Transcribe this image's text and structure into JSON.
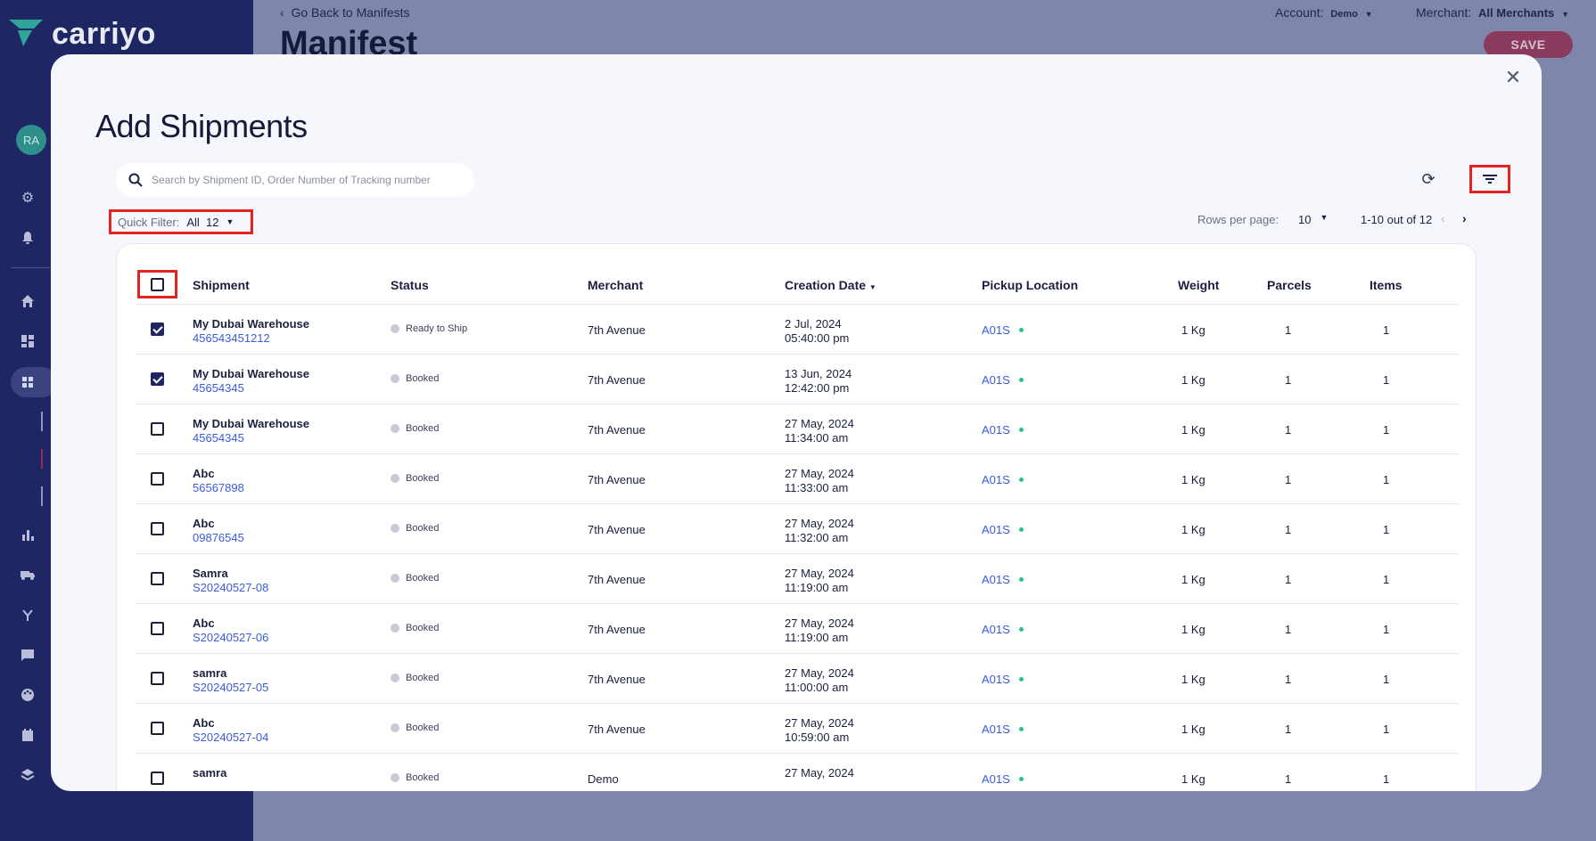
{
  "sidebar": {
    "brand": "carriyo",
    "avatar_initials": "RA",
    "icons": [
      "settings-icon",
      "bell-icon",
      "home-icon",
      "dashboard-icon",
      "shipments-icon",
      "analytics-icon",
      "truck-icon",
      "routing-icon",
      "chat-icon",
      "palette-icon",
      "calendar-icon",
      "layers-icon"
    ]
  },
  "background": {
    "back_link": "Go Back to Manifests",
    "page_title": "Manifest",
    "account_label": "Account:",
    "account_value": "Demo",
    "merchant_label": "Merchant:",
    "merchant_value": "All Merchants",
    "save_label": "SAVE"
  },
  "modal": {
    "title": "Add Shipments",
    "search_placeholder": "Search by Shipment ID, Order Number of Tracking number",
    "quick_filter_label": "Quick Filter:",
    "quick_filter_value": "All",
    "quick_filter_count": "12",
    "rows_per_page_label": "Rows per page:",
    "rows_per_page_value": "10",
    "page_range": "1-10 out of 12"
  },
  "table": {
    "headers": {
      "shipment": "Shipment",
      "status": "Status",
      "merchant": "Merchant",
      "creation_date": "Creation Date",
      "pickup_location": "Pickup Location",
      "weight": "Weight",
      "parcels": "Parcels",
      "items": "Items"
    },
    "rows": [
      {
        "name": "My Dubai Warehouse",
        "id": "456543451212",
        "status": "Ready to Ship",
        "merchant": "7th Avenue",
        "date": "2 Jul, 2024",
        "time": "05:40:00 pm",
        "pickup": "A01S",
        "weight": "1 Kg",
        "parcels": "1",
        "items": "1",
        "checked": true
      },
      {
        "name": "My Dubai Warehouse",
        "id": "45654345",
        "status": "Booked",
        "merchant": "7th Avenue",
        "date": "13 Jun, 2024",
        "time": "12:42:00 pm",
        "pickup": "A01S",
        "weight": "1 Kg",
        "parcels": "1",
        "items": "1",
        "checked": true
      },
      {
        "name": "My Dubai Warehouse",
        "id": "45654345",
        "status": "Booked",
        "merchant": "7th Avenue",
        "date": "27 May, 2024",
        "time": "11:34:00 am",
        "pickup": "A01S",
        "weight": "1 Kg",
        "parcels": "1",
        "items": "1",
        "checked": false
      },
      {
        "name": "Abc",
        "id": "56567898",
        "status": "Booked",
        "merchant": "7th Avenue",
        "date": "27 May, 2024",
        "time": "11:33:00 am",
        "pickup": "A01S",
        "weight": "1 Kg",
        "parcels": "1",
        "items": "1",
        "checked": false
      },
      {
        "name": "Abc",
        "id": "09876545",
        "status": "Booked",
        "merchant": "7th Avenue",
        "date": "27 May, 2024",
        "time": "11:32:00 am",
        "pickup": "A01S",
        "weight": "1 Kg",
        "parcels": "1",
        "items": "1",
        "checked": false
      },
      {
        "name": "Samra",
        "id": "S20240527-08",
        "status": "Booked",
        "merchant": "7th Avenue",
        "date": "27 May, 2024",
        "time": "11:19:00 am",
        "pickup": "A01S",
        "weight": "1 Kg",
        "parcels": "1",
        "items": "1",
        "checked": false
      },
      {
        "name": "Abc",
        "id": "S20240527-06",
        "status": "Booked",
        "merchant": "7th Avenue",
        "date": "27 May, 2024",
        "time": "11:19:00 am",
        "pickup": "A01S",
        "weight": "1 Kg",
        "parcels": "1",
        "items": "1",
        "checked": false
      },
      {
        "name": "samra",
        "id": "S20240527-05",
        "status": "Booked",
        "merchant": "7th Avenue",
        "date": "27 May, 2024",
        "time": "11:00:00 am",
        "pickup": "A01S",
        "weight": "1 Kg",
        "parcels": "1",
        "items": "1",
        "checked": false
      },
      {
        "name": "Abc",
        "id": "S20240527-04",
        "status": "Booked",
        "merchant": "7th Avenue",
        "date": "27 May, 2024",
        "time": "10:59:00 am",
        "pickup": "A01S",
        "weight": "1 Kg",
        "parcels": "1",
        "items": "1",
        "checked": false
      },
      {
        "name": "samra",
        "id": "",
        "status": "Booked",
        "merchant": "Demo",
        "date": "27 May, 2024",
        "time": "",
        "pickup": "A01S",
        "weight": "1 Kg",
        "parcels": "1",
        "items": "1",
        "checked": false
      }
    ]
  },
  "colors": {
    "sidebar": "#1e2664",
    "link": "#3b5bdb",
    "highlight": "#e32222",
    "status_dot": "#c7c9d3",
    "pickup_dot": "#25c48a"
  }
}
